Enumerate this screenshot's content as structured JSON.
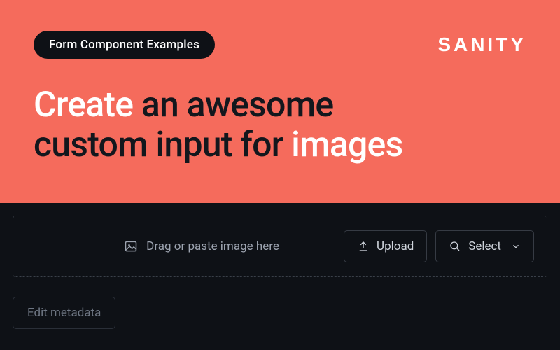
{
  "hero": {
    "badge": "Form Component Examples",
    "brand": "SANITY",
    "headline_create": "Create",
    "headline_mid_1": " an awesome",
    "headline_mid_2": "custom input for ",
    "headline_images": "images"
  },
  "dropzone": {
    "hint": "Drag or paste image here"
  },
  "buttons": {
    "upload": "Upload",
    "select": "Select",
    "edit_metadata": "Edit metadata"
  }
}
